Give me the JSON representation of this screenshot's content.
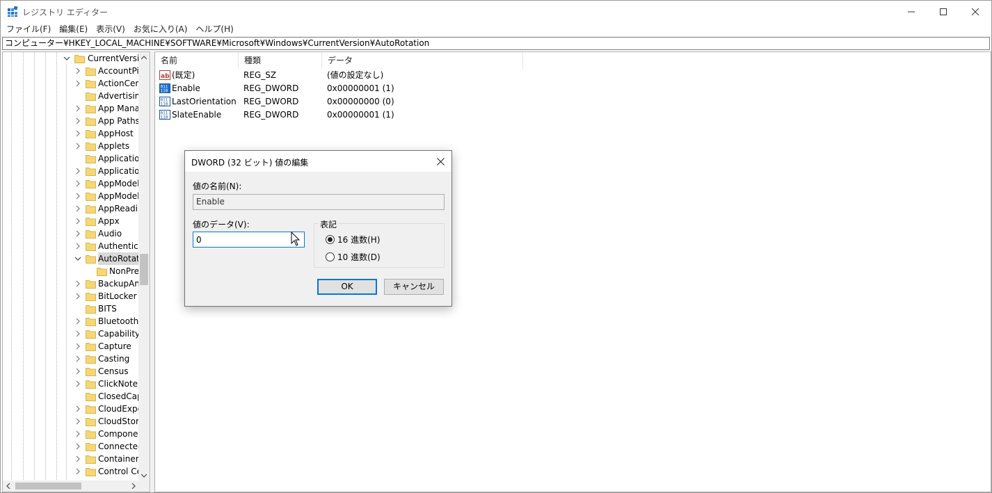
{
  "window": {
    "title": "レジストリ エディター"
  },
  "menu": [
    "ファイル(F)",
    "編集(E)",
    "表示(V)",
    "お気に入り(A)",
    "ヘルプ(H)"
  ],
  "address": "コンピューター¥HKEY_LOCAL_MACHINE¥SOFTWARE¥Microsoft¥Windows¥CurrentVersion¥AutoRotation",
  "tree": {
    "parent": "CurrentVersion",
    "items": [
      {
        "label": "AccountPic",
        "expandable": true
      },
      {
        "label": "ActionCent",
        "expandable": true
      },
      {
        "label": "Advertising",
        "expandable": false
      },
      {
        "label": "App Manag",
        "expandable": true
      },
      {
        "label": "App Paths",
        "expandable": true
      },
      {
        "label": "AppHost",
        "expandable": true
      },
      {
        "label": "Applets",
        "expandable": true
      },
      {
        "label": "Application",
        "expandable": false
      },
      {
        "label": "Application",
        "expandable": true
      },
      {
        "label": "AppModel",
        "expandable": true
      },
      {
        "label": "AppModelU",
        "expandable": true
      },
      {
        "label": "AppReadin",
        "expandable": true
      },
      {
        "label": "Appx",
        "expandable": true
      },
      {
        "label": "Audio",
        "expandable": true
      },
      {
        "label": "Authenticat",
        "expandable": true
      },
      {
        "label": "AutoRotatio",
        "expandable": true,
        "expanded": true,
        "selected": true
      },
      {
        "label": "NonPres",
        "expandable": false,
        "child": true
      },
      {
        "label": "BackupAnc",
        "expandable": true
      },
      {
        "label": "BitLocker",
        "expandable": true
      },
      {
        "label": "BITS",
        "expandable": false
      },
      {
        "label": "Bluetooth",
        "expandable": true
      },
      {
        "label": "CapabilityA",
        "expandable": true
      },
      {
        "label": "Capture",
        "expandable": true
      },
      {
        "label": "Casting",
        "expandable": true
      },
      {
        "label": "Census",
        "expandable": true
      },
      {
        "label": "ClickNote",
        "expandable": true
      },
      {
        "label": "ClosedCapt",
        "expandable": false
      },
      {
        "label": "CloudExper",
        "expandable": true
      },
      {
        "label": "CloudStore",
        "expandable": true
      },
      {
        "label": "Componen",
        "expandable": true
      },
      {
        "label": "Connected",
        "expandable": true
      },
      {
        "label": "ContainerM",
        "expandable": true
      },
      {
        "label": "Control Cer",
        "expandable": true
      }
    ]
  },
  "values": {
    "columns": [
      "名前",
      "種類",
      "データ"
    ],
    "rows": [
      {
        "icon": "string-value-icon",
        "name": "(既定)",
        "type": "REG_SZ",
        "data": "(値の設定なし)"
      },
      {
        "icon": "binary-value-icon",
        "name": "Enable",
        "type": "REG_DWORD",
        "data": "0x00000001 (1)"
      },
      {
        "icon": "binary-value-icon",
        "name": "LastOrientation",
        "type": "REG_DWORD",
        "data": "0x00000000 (0)"
      },
      {
        "icon": "binary-value-icon",
        "name": "SlateEnable",
        "type": "REG_DWORD",
        "data": "0x00000001 (1)"
      }
    ]
  },
  "dialog": {
    "title": "DWORD (32 ビット) 値の編集",
    "name_label": "値の名前(N):",
    "name_value": "Enable",
    "data_label": "値のデータ(V):",
    "data_value": "0",
    "radix_legend": "表記",
    "radix_hex": "16 進数(H)",
    "radix_dec": "10 進数(D)",
    "radix_selected": "hex",
    "ok": "OK",
    "cancel": "キャンセル"
  },
  "colors": {
    "accent": "#0078d7",
    "folder": "#f7d774"
  }
}
